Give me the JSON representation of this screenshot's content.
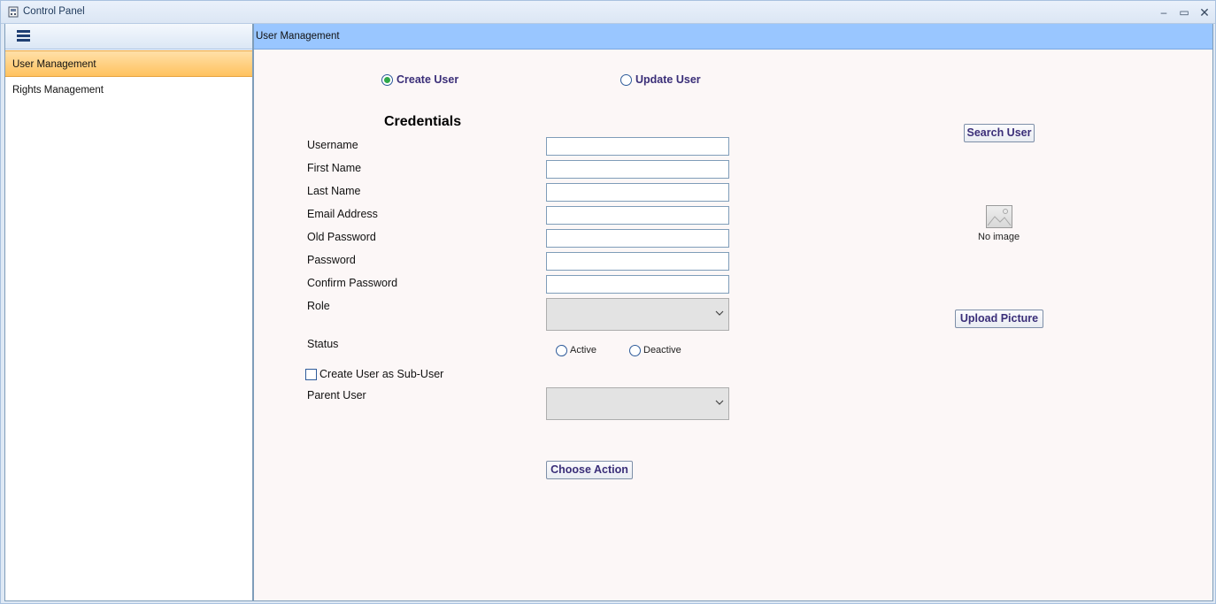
{
  "window": {
    "title": "Control Panel",
    "minimize_glyph": "–",
    "maximize_glyph": "▭",
    "close_glyph": "✕"
  },
  "sidebar": {
    "menu_icon": "hamburger-icon",
    "items": [
      {
        "label": "User Management",
        "active": true
      },
      {
        "label": "Rights Management",
        "active": false
      }
    ]
  },
  "main": {
    "header_title": "User Management",
    "mode": {
      "options": [
        "Create User",
        "Update User"
      ],
      "selected": "Create User"
    },
    "section_title": "Credentials",
    "fields": {
      "username": {
        "label": "Username",
        "value": ""
      },
      "first_name": {
        "label": "First Name",
        "value": ""
      },
      "last_name": {
        "label": "Last Name",
        "value": ""
      },
      "email": {
        "label": "Email Address",
        "value": ""
      },
      "old_password": {
        "label": "Old Password",
        "value": ""
      },
      "password": {
        "label": "Password",
        "value": ""
      },
      "confirm_password": {
        "label": "Confirm Password",
        "value": ""
      },
      "role": {
        "label": "Role",
        "value": ""
      }
    },
    "status": {
      "label": "Status",
      "options": [
        "Active",
        "Deactive"
      ],
      "selected": ""
    },
    "sub_user": {
      "label": "Create User as Sub-User",
      "checked": false
    },
    "parent_user": {
      "label": "Parent User",
      "value": ""
    },
    "buttons": {
      "search_user": "Search User",
      "upload_picture": "Upload Picture",
      "choose_action": "Choose Action"
    },
    "picture": {
      "placeholder_text": "No image",
      "icon": "image-placeholder-icon"
    }
  },
  "colors": {
    "header_blue": "#99c6ff",
    "active_nav": "#ffc25f",
    "button_text": "#3a2e78",
    "radio_checked": "#2ea84a"
  }
}
